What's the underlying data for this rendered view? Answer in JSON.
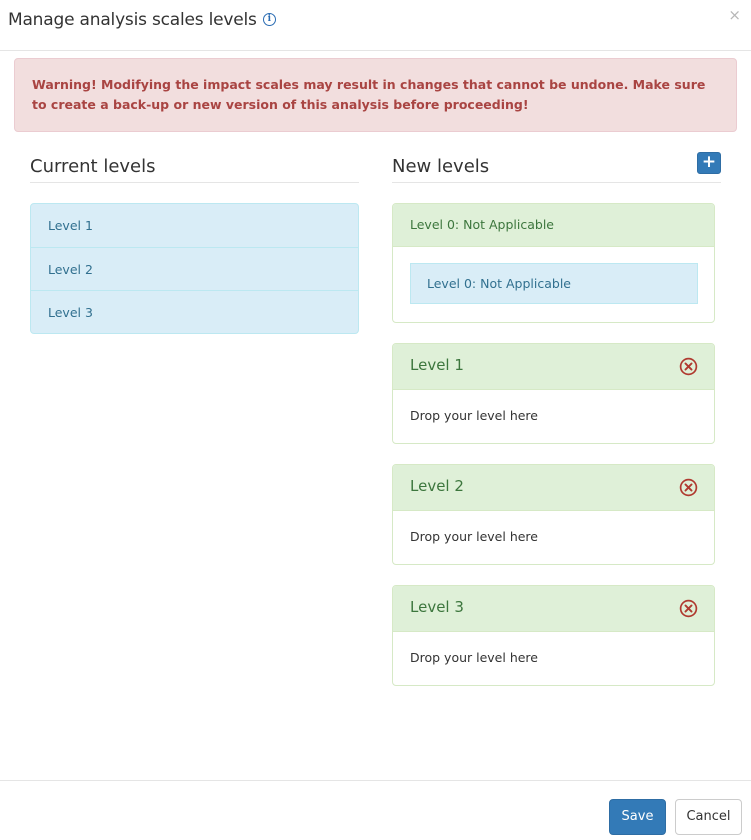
{
  "modal": {
    "title": "Manage analysis scales levels",
    "info_icon": "info-icon",
    "close_label": "×"
  },
  "alert": {
    "text": "Warning! Modifying the impact scales may result in changes that cannot be undone. Make sure to create a back-up or new version of this analysis before proceeding!"
  },
  "current": {
    "title": "Current levels",
    "items": [
      {
        "label": "Level 1"
      },
      {
        "label": "Level 2"
      },
      {
        "label": "Level 3"
      }
    ]
  },
  "new_levels": {
    "title": "New levels",
    "add_label": "+",
    "panels": [
      {
        "title": "Level 0: Not Applicable",
        "assigned": "Level 0: Not Applicable",
        "removable": false
      },
      {
        "title": "Level 1",
        "placeholder": "Drop your level here",
        "removable": true
      },
      {
        "title": "Level 2",
        "placeholder": "Drop your level here",
        "removable": true
      },
      {
        "title": "Level 3",
        "placeholder": "Drop your level here",
        "removable": true
      }
    ]
  },
  "footer": {
    "save_label": "Save",
    "cancel_label": "Cancel"
  },
  "colors": {
    "primary": "#337ab7",
    "danger_text": "#a94442",
    "danger_bg": "#f2dede",
    "success_bg": "#dff0d8",
    "info_bg": "#d9edf7",
    "remove_icon": "#b03a30"
  }
}
